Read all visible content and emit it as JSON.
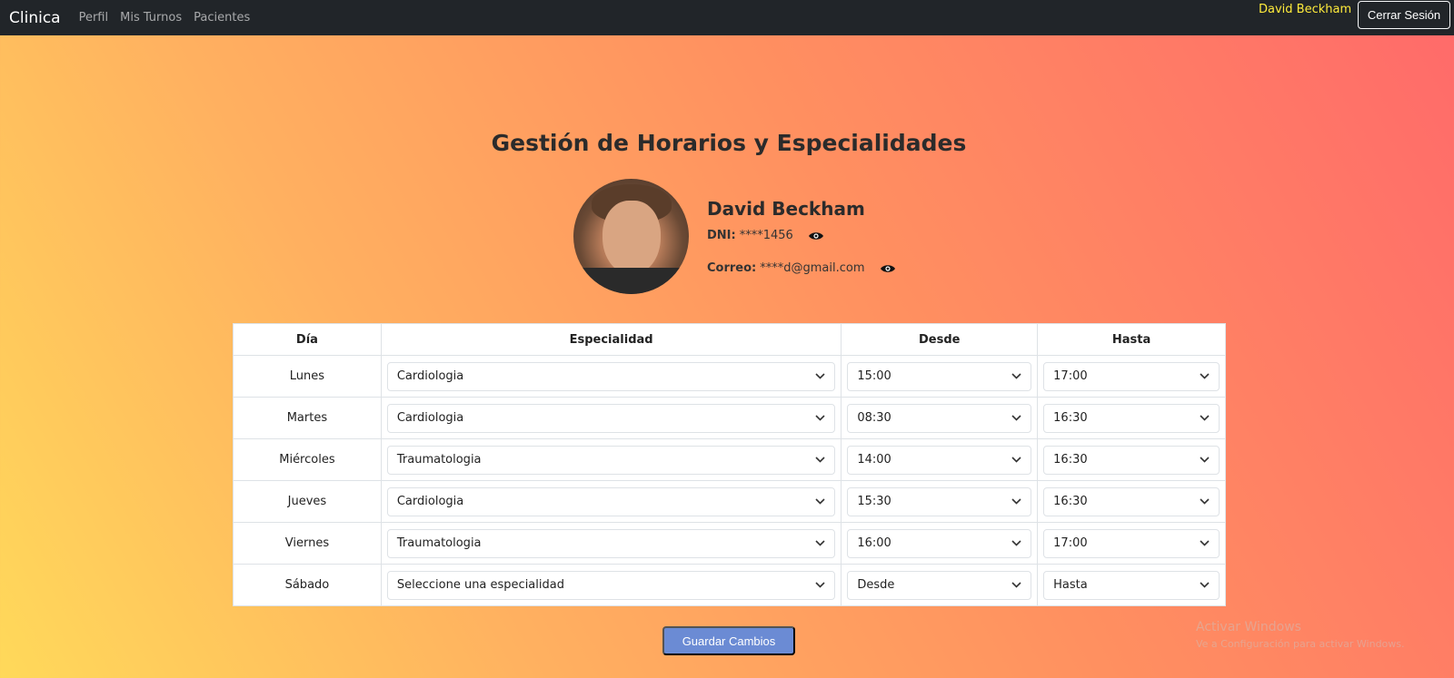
{
  "navbar": {
    "brand": "Clinica",
    "links": [
      "Perfil",
      "Mis Turnos",
      "Pacientes"
    ],
    "user_name": "David Beckham",
    "logout_label": "Cerrar Sesión"
  },
  "page": {
    "title": "Gestión de Horarios y Especialidades"
  },
  "profile": {
    "name": "David Beckham",
    "dni_label": "DNI:",
    "dni_value": "****1456",
    "email_label": "Correo:",
    "email_value": "****d@gmail.com"
  },
  "table": {
    "headers": [
      "Día",
      "Especialidad",
      "Desde",
      "Hasta"
    ],
    "rows": [
      {
        "day": "Lunes",
        "specialty": "Cardiologia",
        "from": "15:00",
        "to": "17:00"
      },
      {
        "day": "Martes",
        "specialty": "Cardiologia",
        "from": "08:30",
        "to": "16:30"
      },
      {
        "day": "Miércoles",
        "specialty": "Traumatologia",
        "from": "14:00",
        "to": "16:30"
      },
      {
        "day": "Jueves",
        "specialty": "Cardiologia",
        "from": "15:30",
        "to": "16:30"
      },
      {
        "day": "Viernes",
        "specialty": "Traumatologia",
        "from": "16:00",
        "to": "17:00"
      },
      {
        "day": "Sábado",
        "specialty": "Seleccione una especialidad",
        "from": "Desde",
        "to": "Hasta"
      }
    ]
  },
  "save_label": "Guardar Cambios",
  "watermark": {
    "line1": "Activar Windows",
    "line2": "Ve a Configuración para activar Windows."
  },
  "colors": {
    "navbar_bg": "#212529",
    "user_name": "#ffeb3b",
    "save_button": "#6b8bd4"
  }
}
